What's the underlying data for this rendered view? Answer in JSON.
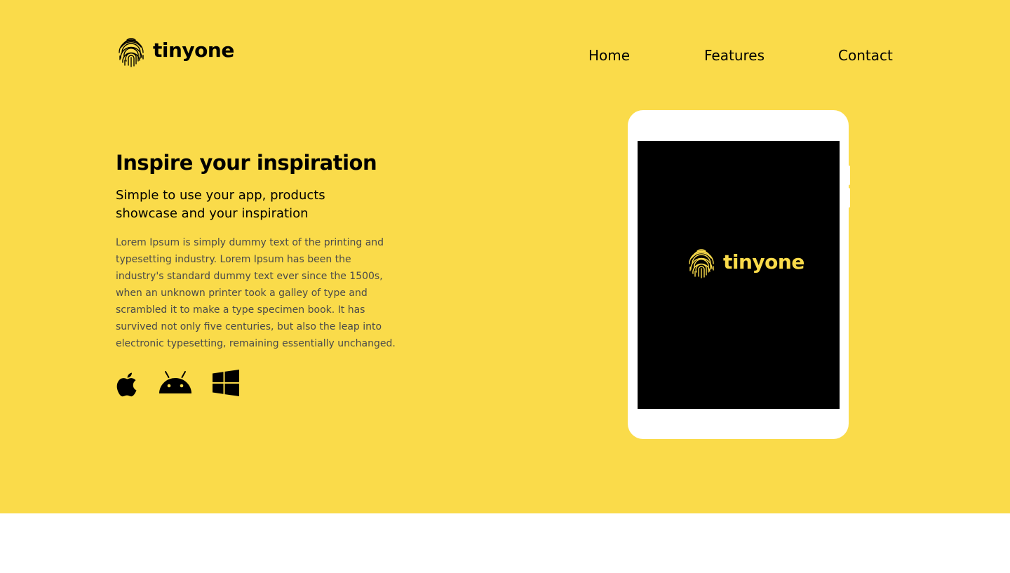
{
  "brand": {
    "name": "tinyone",
    "accent_color": "#FADB4A",
    "logo_icon": "fingerprint-icon"
  },
  "nav": {
    "items": [
      {
        "label": "Home"
      },
      {
        "label": "Features"
      },
      {
        "label": "Contact"
      }
    ]
  },
  "hero": {
    "headline": "Inspire your inspiration",
    "subheadline": "Simple to use your app, products showcase and your inspiration",
    "body": "Lorem Ipsum is simply dummy text of the printing and typesetting industry. Lorem Ipsum has been the industry's standard dummy text ever since the 1500s, when an unknown printer took a galley of type and scrambled it to make a type specimen book. It has survived not only five centuries, but also the leap into electronic typesetting, remaining essentially unchanged.",
    "platforms": [
      {
        "icon": "apple-icon"
      },
      {
        "icon": "android-icon"
      },
      {
        "icon": "windows-icon"
      }
    ]
  },
  "device": {
    "type": "tablet",
    "screen_brand": "tinyone",
    "screen_background": "#000000"
  }
}
